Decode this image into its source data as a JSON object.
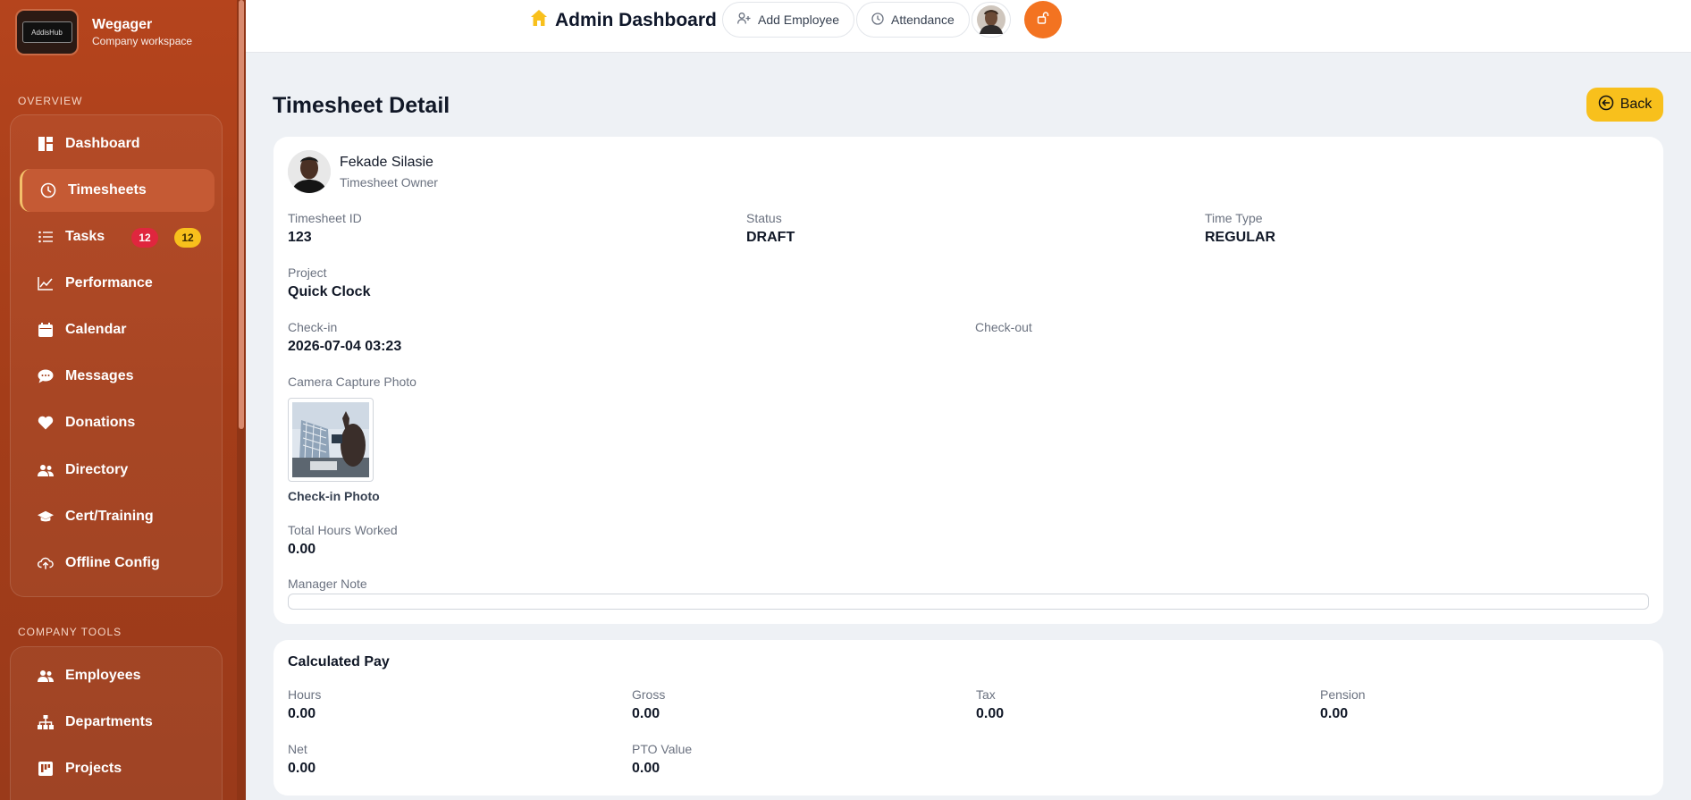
{
  "sidebar": {
    "brand_name": "Wegager",
    "brand_sub": "Company workspace",
    "brand_logo_text": "AddisHub",
    "overview_label": "OVERVIEW",
    "tools_label": "COMPANY TOOLS",
    "items": [
      {
        "label": "Dashboard",
        "icon": "dashboard-icon"
      },
      {
        "label": "Timesheets",
        "icon": "clock-icon",
        "active": true
      },
      {
        "label": "Tasks",
        "icon": "list-icon",
        "badge_red": "12",
        "badge_yellow": "12"
      },
      {
        "label": "Performance",
        "icon": "chart-line-icon"
      },
      {
        "label": "Calendar",
        "icon": "calendar-icon"
      },
      {
        "label": "Messages",
        "icon": "chat-icon"
      },
      {
        "label": "Donations",
        "icon": "heart-icon"
      },
      {
        "label": "Directory",
        "icon": "users-icon"
      },
      {
        "label": "Cert/Training",
        "icon": "graduation-cap-icon"
      },
      {
        "label": "Offline Config",
        "icon": "cloud-upload-icon"
      }
    ],
    "tools": [
      {
        "label": "Employees",
        "icon": "users-icon"
      },
      {
        "label": "Departments",
        "icon": "sitemap-icon"
      },
      {
        "label": "Projects",
        "icon": "project-icon"
      }
    ]
  },
  "topbar": {
    "title": "Admin Dashboard",
    "add_employee": "Add Employee",
    "attendance": "Attendance"
  },
  "page": {
    "title": "Timesheet Detail",
    "back": "Back"
  },
  "detail": {
    "owner_name": "Fekade Silasie",
    "owner_role": "Timesheet Owner",
    "timesheet_id_label": "Timesheet ID",
    "timesheet_id": "123",
    "status_label": "Status",
    "status": "DRAFT",
    "time_type_label": "Time Type",
    "time_type": "REGULAR",
    "project_label": "Project",
    "project": "Quick Clock",
    "checkin_label": "Check-in",
    "checkin": "2026-07-04 03:23",
    "checkout_label": "Check-out",
    "photo_label": "Camera Capture Photo",
    "photo_caption": "Check-in Photo",
    "hours_label": "Total Hours Worked",
    "hours": "0.00",
    "note_label": "Manager Note"
  },
  "pay": {
    "heading": "Calculated Pay",
    "hours_label": "Hours",
    "hours": "0.00",
    "gross_label": "Gross",
    "gross": "0.00",
    "tax_label": "Tax",
    "tax": "0.00",
    "pension_label": "Pension",
    "pension": "0.00",
    "net_label": "Net",
    "net": "0.00",
    "pto_label": "PTO Value",
    "pto": "0.00"
  },
  "colors": {
    "sidebar": "#a43d19",
    "accent_yellow": "#f8c01c",
    "accent_orange": "#f37321",
    "badge_red": "#e0263e"
  }
}
